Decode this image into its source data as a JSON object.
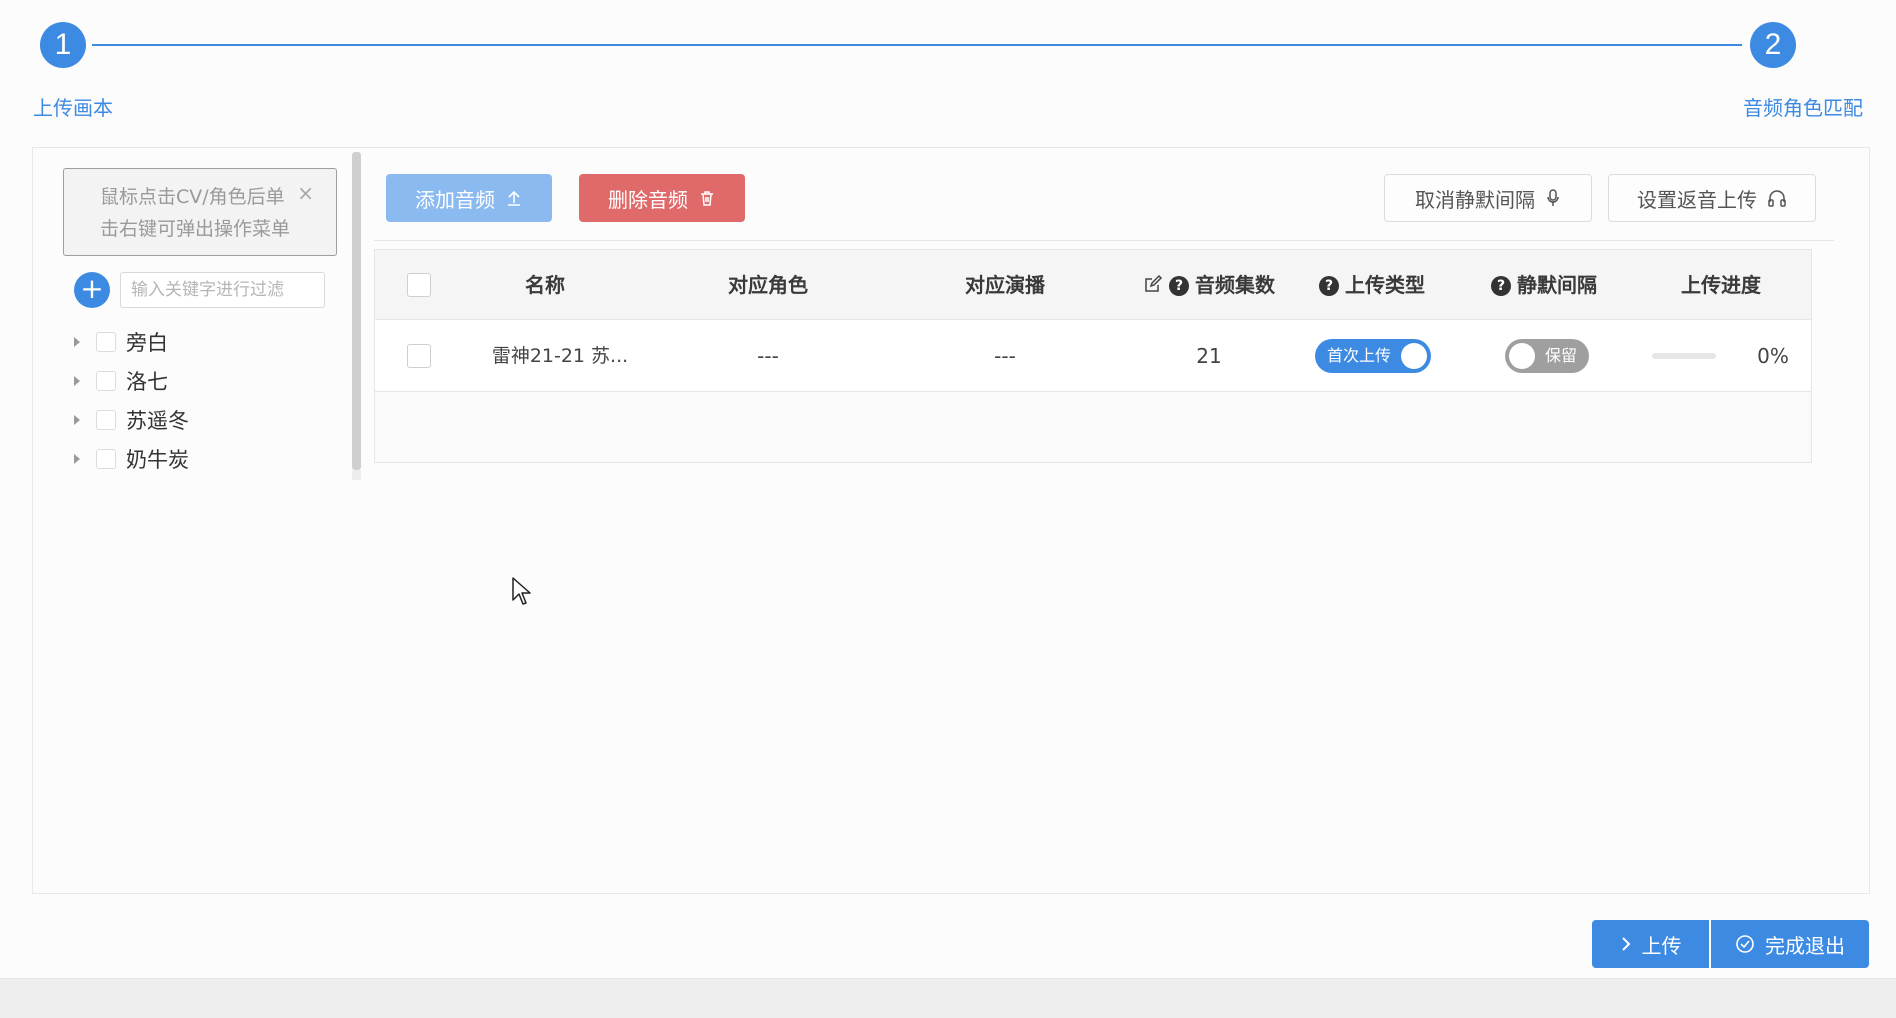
{
  "stepper": {
    "steps": [
      {
        "number": "1",
        "label": "上传画本"
      },
      {
        "number": "2",
        "label": "音频角色匹配"
      }
    ]
  },
  "left_panel": {
    "tip_text_line1": "鼠标点击CV/角色后单",
    "tip_text_line2": "击右键可弹出操作菜单",
    "filter_placeholder": "输入关键字进行过滤",
    "tree_items": [
      {
        "label": "旁白"
      },
      {
        "label": "洛七"
      },
      {
        "label": "苏遥冬"
      },
      {
        "label": "奶牛炭"
      }
    ]
  },
  "toolbar": {
    "add_audio_label": "添加音频",
    "delete_audio_label": "删除音频",
    "cancel_silence_label": "取消静默间隔",
    "set_return_upload_label": "设置返音上传"
  },
  "table": {
    "columns": [
      "名称",
      "对应角色",
      "对应演播",
      "音频集数",
      "上传类型",
      "静默间隔",
      "上传进度"
    ],
    "rows": [
      {
        "name": "雷神21-21 苏...",
        "role": "---",
        "performer": "---",
        "episodes": "21",
        "upload_type": "首次上传",
        "upload_type_on": true,
        "silence": "保留",
        "silence_on": false,
        "progress_text": "0%",
        "progress": 0
      }
    ]
  },
  "footer": {
    "upload_label": "上传",
    "finish_label": "完成退出"
  },
  "colors": {
    "primary": "#3d8ae3",
    "danger": "#e06a6a",
    "primary_light": "#8bbaf0"
  },
  "icons": {
    "add_audio": "upload-icon",
    "delete_audio": "trash-icon",
    "cancel_silence": "microphone-icon",
    "set_return_upload": "headphones-icon",
    "episodes_header": "edit-icon",
    "help": "question-circle-icon",
    "upload_button": "chevron-right-icon",
    "finish_button": "check-circle-icon"
  }
}
